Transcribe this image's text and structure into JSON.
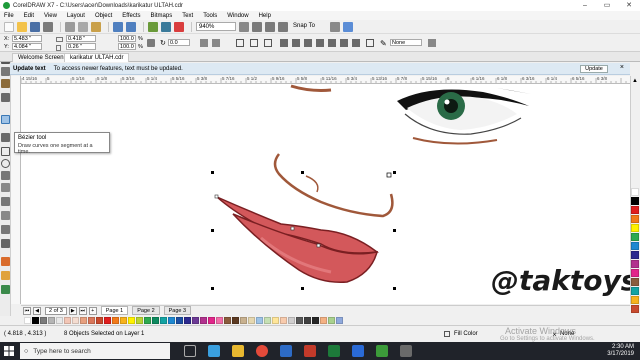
{
  "window": {
    "title": "CorelDRAW X7 - C:\\Users\\acer\\Downloads\\karikatur ULTAH.cdr"
  },
  "window_controls": [
    "–",
    "▭",
    "✕"
  ],
  "menu": [
    "File",
    "Edit",
    "View",
    "Layout",
    "Object",
    "Effects",
    "Bitmaps",
    "Text",
    "Tools",
    "Window",
    "Help"
  ],
  "toolbar": {
    "zoom": "940%",
    "snap_label": "Snap To",
    "outline_width": "None"
  },
  "property_bar": {
    "x_label": "X:",
    "x_value": "5.483 \"",
    "y_label": "Y:",
    "y_value": "4.084 \"",
    "w_value": "0.418 \"",
    "h_value": "0.26 \"",
    "scale_w": "100.0",
    "scale_h": "100.0",
    "scale_unit": "%",
    "angle": "0.0"
  },
  "doc_tabs": [
    {
      "label": "Welcome Screen"
    },
    {
      "label": "karikatur ULTAH.cdr"
    }
  ],
  "update_bar": {
    "title": "Update text",
    "message": "To access newer features, text must be updated.",
    "button": "Update"
  },
  "ruler_labels": [
    "4 15/16",
    "5",
    "5 1/16",
    "5 1/8",
    "5 3/16",
    "5 1/4",
    "5 5/16",
    "5 3/8",
    "5 7/16",
    "5 1/2",
    "5 9/16",
    "5 5/8",
    "5 11/16",
    "5 3/4",
    "5 13/16",
    "5 7/8",
    "5 15/16",
    "6",
    "6 1/16",
    "6 1/8",
    "6 3/16",
    "6 1/4",
    "6 5/16",
    "6 3/8"
  ],
  "tooltip": {
    "title": "Bézier tool",
    "description": "Draw curves one segment at a time."
  },
  "watermark_logo": "@taktoys",
  "page_nav": {
    "counter": "2 of 3",
    "pages": [
      "Page 1",
      "Page 2",
      "Page 3"
    ],
    "active_index": 0
  },
  "status": {
    "coords": "( 4.818 , 4.313 )",
    "selection": "8 Objects Selected on Layer 1",
    "fill": "Fill Color",
    "outline": "None"
  },
  "activate_windows": {
    "title": "Activate Windows",
    "subtitle": "Go to Settings to activate Windows."
  },
  "taskbar": {
    "search_placeholder": "Type here to search",
    "time": "2:30 AM",
    "date": "3/17/2019"
  },
  "colors": {
    "lip_red": "#d3585b",
    "lip_dark": "#7a1f22",
    "brow_brown": "#a0583a",
    "eye_green": "#2a6b47",
    "update_bar": "#dde9f3",
    "taskbar": "#20232a"
  },
  "palette_colors": [
    "#ffffff",
    "#000000",
    "#7b7b7b",
    "#b5b5b5",
    "#e8e8e8",
    "#f2c6b6",
    "#f4dcd0",
    "#e7a07f",
    "#d9775b",
    "#c84a2e",
    "#e01e1e",
    "#f27a1a",
    "#f7b21c",
    "#fff200",
    "#b9d433",
    "#2da94f",
    "#0e8a5f",
    "#13a3a3",
    "#1e88d1",
    "#1c4fa3",
    "#2c2a8f",
    "#6d3a96",
    "#b2318e",
    "#e2268a",
    "#f36eaa",
    "#8a5c3c",
    "#5c3a22",
    "#c8b18f",
    "#e5d7b0",
    "#9dc3e6",
    "#c6e0b4",
    "#ffe699",
    "#f8cbad",
    "#d0cece",
    "#595959",
    "#404040",
    "#262626",
    "#f4b183",
    "#a9d18e",
    "#8fa9dc"
  ],
  "right_palette": [
    "#ffffff",
    "#000000",
    "#e01e1e",
    "#f27a1a",
    "#fff200",
    "#2da94f",
    "#1e88d1",
    "#2c2a8f",
    "#b2318e",
    "#e2268a",
    "#8a5c3c",
    "#13a3a3",
    "#f7b21c",
    "#c84a2e"
  ]
}
